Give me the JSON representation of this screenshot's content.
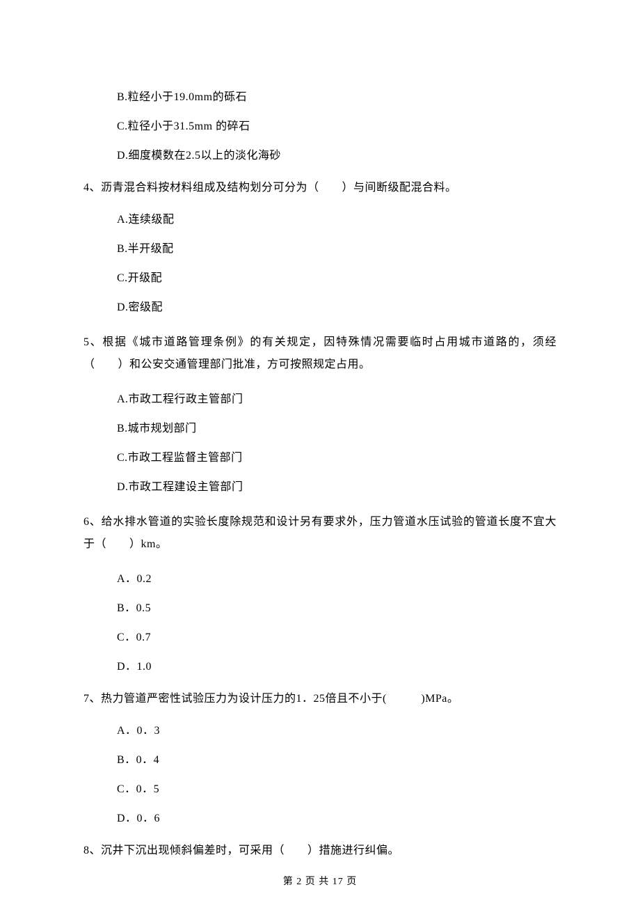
{
  "q3": {
    "options": {
      "B": "B.粒经小于19.0mm的砾石",
      "C": "C.粒径小于31.5mm 的碎石",
      "D": "D.细度模数在2.5以上的淡化海砂"
    }
  },
  "q4": {
    "stem": "4、沥青混合料按材料组成及结构划分可分为（　　）与间断级配混合料。",
    "options": {
      "A": "A.连续级配",
      "B": "B.半开级配",
      "C": "C.开级配",
      "D": "D.密级配"
    }
  },
  "q5": {
    "stem": "5、根据《城市道路管理条例》的有关规定，因特殊情况需要临时占用城市道路的，须经（　　）和公安交通管理部门批准，方可按照规定占用。",
    "options": {
      "A": "A.市政工程行政主管部门",
      "B": "B.城市规划部门",
      "C": "C.市政工程监督主管部门",
      "D": "D.市政工程建设主管部门"
    }
  },
  "q6": {
    "stem": "6、给水排水管道的实验长度除规范和设计另有要求外，压力管道水压试验的管道长度不宜大于（　　）km。",
    "options": {
      "A": "A．0.2",
      "B": "B．0.5",
      "C": "C．0.7",
      "D": "D．1.0"
    }
  },
  "q7": {
    "stem": "7、热力管道严密性试验压力为设计压力的1．25倍且不小于(　　　)MPa。",
    "options": {
      "A": "A．0．3",
      "B": "B．0．4",
      "C": "C．0．5",
      "D": "D．0．6"
    }
  },
  "q8": {
    "stem": "8、沉井下沉出现倾斜偏差时，可采用（　　）措施进行纠偏。"
  },
  "footer": "第 2 页 共 17 页"
}
